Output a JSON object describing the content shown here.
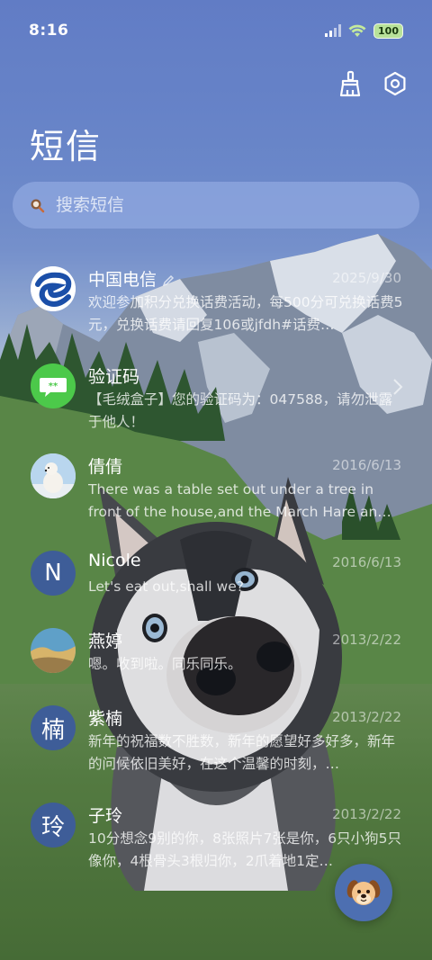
{
  "status": {
    "time": "8:16",
    "battery": "100",
    "icons": [
      "signal-icon",
      "wifi-icon",
      "battery-icon"
    ]
  },
  "toolbar": {
    "icons": [
      "broom-icon",
      "settings-icon"
    ]
  },
  "title": "短信",
  "search": {
    "placeholder": "搜索短信",
    "icon": "search-icon"
  },
  "messages": [
    {
      "name": "中国电信",
      "date": "2025/9/30",
      "text": "欢迎参加积分兑换话费活动，每500分可兑换话费5元，兑换话费请回复106或jfdh#话费…",
      "avatar": "china-telecom-logo"
    },
    {
      "name": "验证码",
      "date": "",
      "text": "【毛绒盒子】您的验证码为：047588，请勿泄露于他人！",
      "avatar": "chat-bubble-icon"
    },
    {
      "name": "倩倩",
      "date": "2016/6/13",
      "text": "There was a table set out under a tree in front of the house,and the March Hare an…",
      "avatar": "polar-bear-photo"
    },
    {
      "name": "Nicole",
      "date": "2016/6/13",
      "text": "Let's eat out,shall we?",
      "avatar_letter": "N"
    },
    {
      "name": "燕婷",
      "date": "2013/2/22",
      "text": "嗯。收到啦。同乐同乐。",
      "avatar": "landscape-photo"
    },
    {
      "name": "紫楠",
      "date": "2013/2/22",
      "text": "新年的祝福数不胜数，新年的愿望好多好多，新年的问候依旧美好，在这个温馨的时刻，…",
      "avatar_letter": "楠"
    },
    {
      "name": "子玲",
      "date": "2013/2/22",
      "text": "10分想念9别的你，8张照片7张是你，6只小狗5只像你，4根骨头3根归你，2爪着地1定…",
      "avatar_letter": "玲"
    }
  ],
  "fab": {
    "icon": "dog-face-icon"
  },
  "colors": {
    "accent": "#3e5d98",
    "search_bg": "#91aae1",
    "telecom_blue": "#1b4fa8",
    "verify_green": "#4cc94a"
  }
}
